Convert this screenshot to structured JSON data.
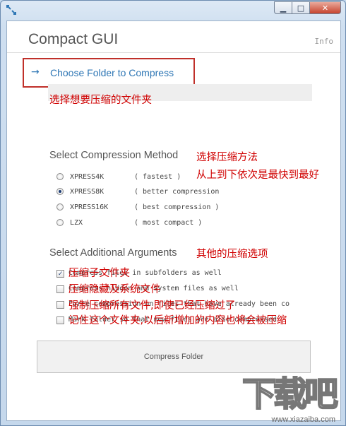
{
  "window": {
    "min_glyph": "▁",
    "max_glyph": "□",
    "close_glyph": "✕"
  },
  "app": {
    "title": "Compact GUI",
    "info_label": "Info"
  },
  "choose": {
    "arrow": "→",
    "label": "Choose Folder to Compress"
  },
  "annotations": {
    "choose": "选择想要压缩的文件夹",
    "method": "选择压缩方法",
    "order": "从上到下依次是最快到最好",
    "arguments": "其他的压缩选项",
    "arg1": "压缩子文件夹",
    "arg2": "压缩隐藏及系统文件",
    "arg3": "强制压缩所有文件,即使已经压缩过了",
    "arg4": "记住这个文件夹,以后新增加的内容也将会被压缩"
  },
  "method": {
    "heading": "Select Compression Method",
    "options": [
      {
        "name": "XPRESS4K",
        "desc": "( fastest )",
        "selected": false
      },
      {
        "name": "XPRESS8K",
        "desc": "( better compression",
        "selected": true
      },
      {
        "name": "XPRESS16K",
        "desc": "( best compression )",
        "selected": false
      },
      {
        "name": "LZX",
        "desc": "( most compact )",
        "selected": false
      }
    ]
  },
  "arguments": {
    "heading": "Select Additional Arguments",
    "options": [
      {
        "text": "Compress files in subfolders as well",
        "checked": true,
        "check_glyph": "✓"
      },
      {
        "text": "Compress hidden and system files as well",
        "checked": false,
        "check_glyph": ""
      },
      {
        "text": "Force compression on files that have already been co",
        "checked": false,
        "check_glyph": ""
      },
      {
        "text": "Mark folder so that new files are also compressed",
        "checked": false,
        "check_glyph": ""
      }
    ]
  },
  "compress_button": "Compress Folder",
  "watermark": {
    "logo_text": "下载吧",
    "url": "www.xiazaiba.com"
  }
}
